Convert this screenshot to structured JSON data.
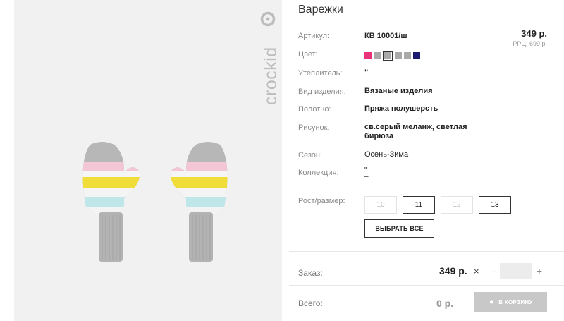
{
  "brand": {
    "name": "crockid"
  },
  "product": {
    "title": "Варежки",
    "price": "349 р.",
    "rrp": "РРЦ: 699 р."
  },
  "specs": {
    "article": {
      "label": "Артикул:",
      "value": "КВ 10001/ш"
    },
    "color": {
      "label": "Цвет:"
    },
    "insulation": {
      "label": "Утеплитель:",
      "value": "\""
    },
    "kind": {
      "label": "Вид изделия:",
      "value": "Вязаные изделия"
    },
    "fabric": {
      "label": "Полотно:",
      "value": "Пряжа полушерсть"
    },
    "pattern": {
      "label": "Рисунок:",
      "value": "св.серый меланж, светлая бирюза"
    },
    "season": {
      "label": "Сезон:",
      "value": "Осень-Зима"
    },
    "collection": {
      "label": "Коллекция:",
      "value": "\"\n–"
    },
    "size": {
      "label": "Рост/размер:"
    }
  },
  "swatches": [
    {
      "color": "#e8337a",
      "selected": false
    },
    {
      "color": "#a9a9a9",
      "selected": false
    },
    {
      "color": "#a9a9a9",
      "selected": true
    },
    {
      "color": "#a9a9a9",
      "selected": false
    },
    {
      "color": "#a9a9a9",
      "selected": false
    },
    {
      "color": "#1a1a6e",
      "selected": false
    }
  ],
  "sizes": [
    {
      "label": "10",
      "available": false
    },
    {
      "label": "11",
      "available": true
    },
    {
      "label": "12",
      "available": false
    },
    {
      "label": "13",
      "available": true
    }
  ],
  "select_all_label": "ВЫБРАТЬ ВСЕ",
  "order": {
    "label": "Заказ:",
    "price": "349 р.",
    "times_icon": "×",
    "minus_icon": "−",
    "plus_icon": "+",
    "quantity": ""
  },
  "total": {
    "label": "Всего:",
    "value": "0 р.",
    "cart_label": "В КОРЗИНУ",
    "cart_icon": "cart-icon"
  }
}
